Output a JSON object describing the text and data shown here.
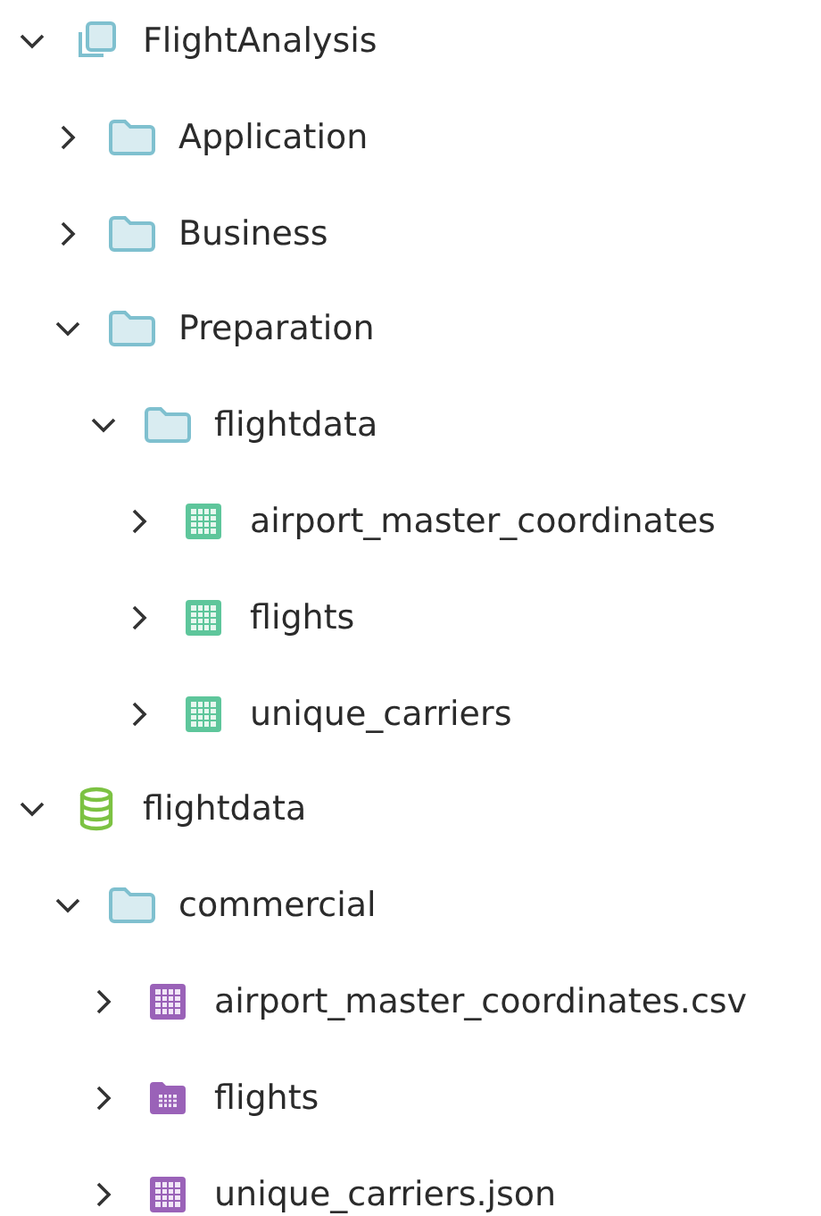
{
  "tree": [
    {
      "label": "FlightAnalysis",
      "kind": "project",
      "expanded": true,
      "children": [
        {
          "label": "Application",
          "kind": "folder",
          "expanded": false
        },
        {
          "label": "Business",
          "kind": "folder",
          "expanded": false
        },
        {
          "label": "Preparation",
          "kind": "folder",
          "expanded": true,
          "children": [
            {
              "label": "flightdata",
              "kind": "folder",
              "expanded": true,
              "children": [
                {
                  "label": "airport_master_coordinates",
                  "kind": "dataset",
                  "expanded": false
                },
                {
                  "label": "flights",
                  "kind": "dataset",
                  "expanded": false
                },
                {
                  "label": "unique_carriers",
                  "kind": "dataset",
                  "expanded": false
                }
              ]
            }
          ]
        }
      ]
    },
    {
      "label": "flightdata",
      "kind": "database",
      "expanded": true,
      "children": [
        {
          "label": "commercial",
          "kind": "folder",
          "expanded": true,
          "children": [
            {
              "label": "airport_master_coordinates.csv",
              "kind": "file",
              "expanded": false
            },
            {
              "label": "flights",
              "kind": "table-folder",
              "expanded": false
            },
            {
              "label": "unique_carriers.json",
              "kind": "file",
              "expanded": false
            }
          ]
        }
      ]
    }
  ]
}
